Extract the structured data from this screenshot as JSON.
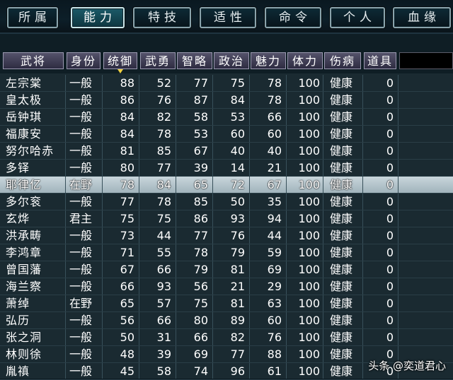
{
  "tabs": [
    {
      "label": "所属",
      "active": false
    },
    {
      "label": "能力",
      "active": true
    },
    {
      "label": "特技",
      "active": false
    },
    {
      "label": "适性",
      "active": false
    },
    {
      "label": "命令",
      "active": false
    },
    {
      "label": "个人",
      "active": false
    },
    {
      "label": "血缘",
      "active": false
    }
  ],
  "columns": [
    "武将",
    "身份",
    "统御",
    "武勇",
    "智略",
    "政治",
    "魅力",
    "体力",
    "伤病",
    "道具"
  ],
  "sorted_column": "统御",
  "rows": [
    {
      "name": "左宗棠",
      "rank": "一般",
      "tongyu": "88",
      "wuyong": "52",
      "zhilue": "77",
      "zhengzhi": "75",
      "meili": "78",
      "tili": "100",
      "shangbing": "健康",
      "daoju": "0"
    },
    {
      "name": "皇太极",
      "rank": "一般",
      "tongyu": "86",
      "wuyong": "76",
      "zhilue": "87",
      "zhengzhi": "84",
      "meili": "78",
      "tili": "100",
      "shangbing": "健康",
      "daoju": "0"
    },
    {
      "name": "岳钟琪",
      "rank": "一般",
      "tongyu": "84",
      "wuyong": "82",
      "zhilue": "58",
      "zhengzhi": "53",
      "meili": "66",
      "tili": "100",
      "shangbing": "健康",
      "daoju": "0"
    },
    {
      "name": "福康安",
      "rank": "一般",
      "tongyu": "84",
      "wuyong": "78",
      "zhilue": "53",
      "zhengzhi": "60",
      "meili": "60",
      "tili": "100",
      "shangbing": "健康",
      "daoju": "0"
    },
    {
      "name": "努尔哈赤",
      "rank": "一般",
      "tongyu": "81",
      "wuyong": "85",
      "zhilue": "67",
      "zhengzhi": "40",
      "meili": "40",
      "tili": "100",
      "shangbing": "健康",
      "daoju": "0"
    },
    {
      "name": "多铎",
      "rank": "一般",
      "tongyu": "80",
      "wuyong": "77",
      "zhilue": "39",
      "zhengzhi": "14",
      "meili": "21",
      "tili": "100",
      "shangbing": "健康",
      "daoju": "0"
    },
    {
      "name": "耶律亿",
      "rank": "在野",
      "tongyu": "78",
      "wuyong": "84",
      "zhilue": "65",
      "zhengzhi": "72",
      "meili": "67",
      "tili": "100",
      "shangbing": "健康",
      "daoju": "0",
      "selected": true
    },
    {
      "name": "多尔衮",
      "rank": "一般",
      "tongyu": "77",
      "wuyong": "78",
      "zhilue": "85",
      "zhengzhi": "50",
      "meili": "35",
      "tili": "100",
      "shangbing": "健康",
      "daoju": "0"
    },
    {
      "name": "玄烨",
      "rank": "君主",
      "tongyu": "75",
      "wuyong": "75",
      "zhilue": "86",
      "zhengzhi": "93",
      "meili": "94",
      "tili": "100",
      "shangbing": "健康",
      "daoju": "0"
    },
    {
      "name": "洪承畴",
      "rank": "一般",
      "tongyu": "73",
      "wuyong": "44",
      "zhilue": "77",
      "zhengzhi": "76",
      "meili": "44",
      "tili": "100",
      "shangbing": "健康",
      "daoju": "0"
    },
    {
      "name": "李鸿章",
      "rank": "一般",
      "tongyu": "71",
      "wuyong": "55",
      "zhilue": "78",
      "zhengzhi": "79",
      "meili": "59",
      "tili": "100",
      "shangbing": "健康",
      "daoju": "0"
    },
    {
      "name": "曾国藩",
      "rank": "一般",
      "tongyu": "67",
      "wuyong": "66",
      "zhilue": "79",
      "zhengzhi": "81",
      "meili": "69",
      "tili": "100",
      "shangbing": "健康",
      "daoju": "0"
    },
    {
      "name": "海兰察",
      "rank": "一般",
      "tongyu": "66",
      "wuyong": "93",
      "zhilue": "56",
      "zhengzhi": "21",
      "meili": "29",
      "tili": "100",
      "shangbing": "健康",
      "daoju": "0"
    },
    {
      "name": "萧绰",
      "rank": "在野",
      "tongyu": "65",
      "wuyong": "57",
      "zhilue": "75",
      "zhengzhi": "81",
      "meili": "63",
      "tili": "100",
      "shangbing": "健康",
      "daoju": "0"
    },
    {
      "name": "弘历",
      "rank": "一般",
      "tongyu": "56",
      "wuyong": "66",
      "zhilue": "80",
      "zhengzhi": "89",
      "meili": "60",
      "tili": "100",
      "shangbing": "健康",
      "daoju": "0"
    },
    {
      "name": "张之洞",
      "rank": "一般",
      "tongyu": "50",
      "wuyong": "31",
      "zhilue": "66",
      "zhengzhi": "82",
      "meili": "76",
      "tili": "100",
      "shangbing": "健康",
      "daoju": "0"
    },
    {
      "name": "林则徐",
      "rank": "一般",
      "tongyu": "48",
      "wuyong": "39",
      "zhilue": "69",
      "zhengzhi": "77",
      "meili": "88",
      "tili": "100",
      "shangbing": "健康",
      "daoju": "0"
    },
    {
      "name": "胤禛",
      "rank": "一般",
      "tongyu": "45",
      "wuyong": "58",
      "zhilue": "74",
      "zhengzhi": "96",
      "meili": "61",
      "tili": "100",
      "shangbing": "健康",
      "daoju": "0"
    }
  ],
  "watermark": "头条 @奕道君心",
  "colors": {
    "header_bg": "#3e3c55",
    "selected_row": "#b8c8cf",
    "sort_marker": "#f0d040"
  }
}
